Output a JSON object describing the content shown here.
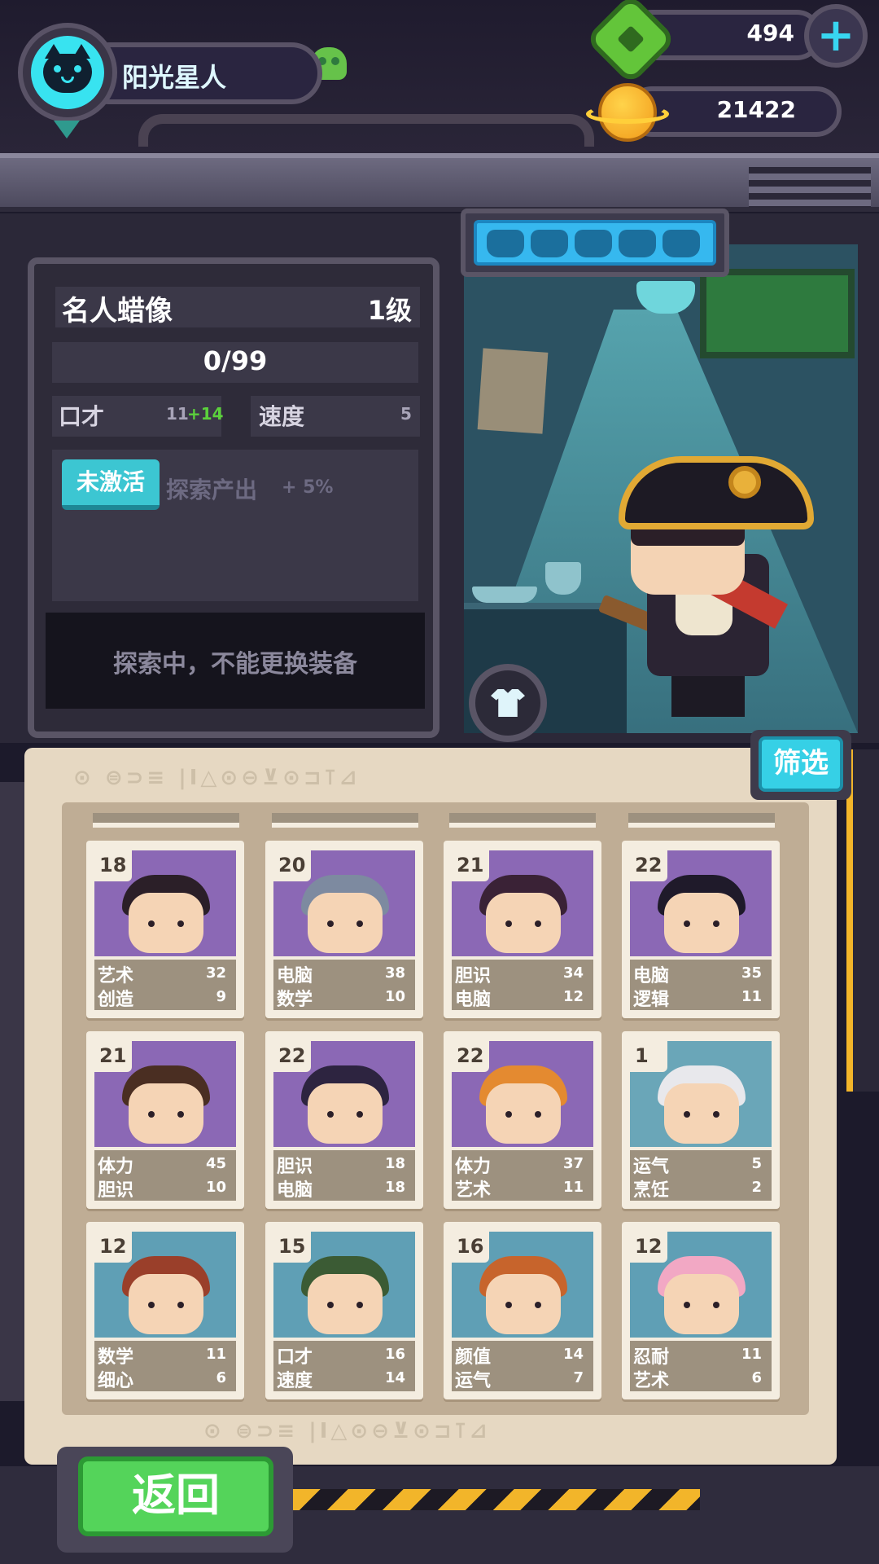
{
  "player": {
    "name": "阳光星人"
  },
  "currency": {
    "gems": "494",
    "coins": "21422",
    "add_icon": "plus-icon"
  },
  "item": {
    "name": "名人蜡像",
    "level": "1级",
    "progress": "0/99",
    "stats": [
      {
        "name": "口才",
        "value": "11",
        "bonus": "+14"
      },
      {
        "name": "速度",
        "value": "5"
      }
    ],
    "status_tag": "未激活",
    "effect_text": "探索产出",
    "effect_value": "+ 5%",
    "notice": "探索中，不能更换装备"
  },
  "cards": [
    {
      "level": "18",
      "stat1": "艺术",
      "val1": "32",
      "stat2": "创造",
      "val2": "9",
      "bg": "#8b68b5",
      "hair": "#2b1f28"
    },
    {
      "level": "20",
      "stat1": "电脑",
      "val1": "38",
      "stat2": "数学",
      "val2": "10",
      "bg": "#8b68b5",
      "hair": "#7d8aa0"
    },
    {
      "level": "21",
      "stat1": "胆识",
      "val1": "34",
      "stat2": "电脑",
      "val2": "12",
      "bg": "#8b68b5",
      "hair": "#3a2236"
    },
    {
      "level": "22",
      "stat1": "电脑",
      "val1": "35",
      "stat2": "逻辑",
      "val2": "11",
      "bg": "#8b68b5",
      "hair": "#1f1a2a"
    },
    {
      "level": "21",
      "stat1": "体力",
      "val1": "45",
      "stat2": "胆识",
      "val2": "10",
      "bg": "#8b68b5",
      "hair": "#4a2e22"
    },
    {
      "level": "22",
      "stat1": "胆识",
      "val1": "18",
      "stat2": "电脑",
      "val2": "18",
      "bg": "#8b68b5",
      "hair": "#2d2440"
    },
    {
      "level": "22",
      "stat1": "体力",
      "val1": "37",
      "stat2": "艺术",
      "val2": "11",
      "bg": "#8b68b5",
      "hair": "#e48a30"
    },
    {
      "level": "1",
      "stat1": "运气",
      "val1": "5",
      "stat2": "烹饪",
      "val2": "2",
      "bg": "#6aa6b8",
      "hair": "#e8e8ec"
    },
    {
      "level": "12",
      "stat1": "数学",
      "val1": "11",
      "stat2": "细心",
      "val2": "6",
      "bg": "#5f9fb5",
      "hair": "#9a3f2a"
    },
    {
      "level": "15",
      "stat1": "口才",
      "val1": "16",
      "stat2": "速度",
      "val2": "14",
      "bg": "#5f9fb5",
      "hair": "#3b5b34"
    },
    {
      "level": "16",
      "stat1": "颜值",
      "val1": "14",
      "stat2": "运气",
      "val2": "7",
      "bg": "#5f9fb5",
      "hair": "#c7642c"
    },
    {
      "level": "12",
      "stat1": "忍耐",
      "val1": "11",
      "stat2": "艺术",
      "val2": "6",
      "bg": "#5f9fb5",
      "hair": "#f2a8c4"
    }
  ],
  "buttons": {
    "filter": "筛选",
    "back": "返回"
  }
}
